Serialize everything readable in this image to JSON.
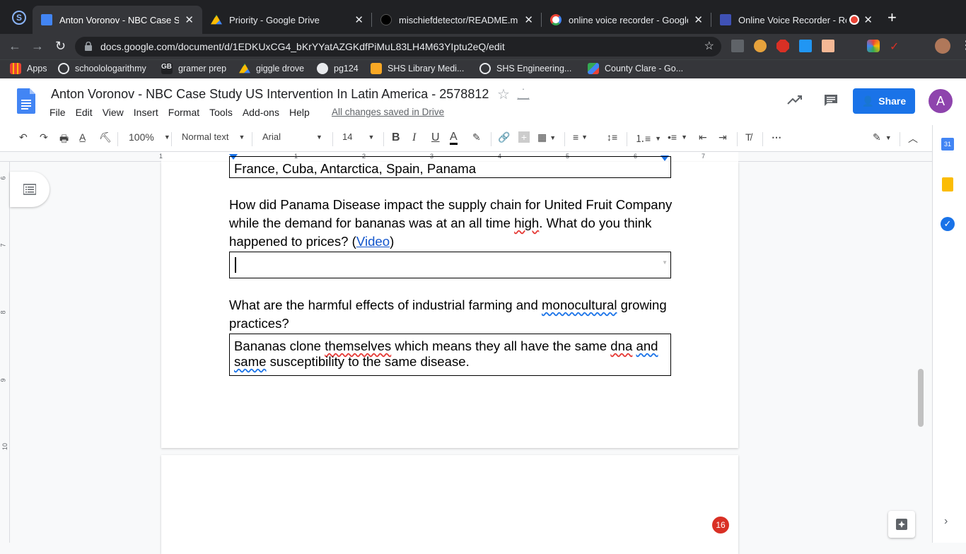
{
  "tabs": [
    {
      "title": "Anton Voronov - NBC Case Stu",
      "icon": "docs-icon",
      "color": "#4285f4"
    },
    {
      "title": "Priority - Google Drive",
      "icon": "drive-icon",
      "color": "#fbbc04"
    },
    {
      "title": "mischiefdetector/README.md",
      "icon": "github-icon",
      "color": "#202124"
    },
    {
      "title": "online voice recorder - Google",
      "icon": "google-icon",
      "color": "#ea4335"
    },
    {
      "title": "Online Voice Recorder - Re",
      "icon": "recorder-icon",
      "color": "#3f51b5"
    }
  ],
  "address": {
    "url": "docs.google.com/document/d/1EDKUxCG4_bKrYYatAZGKdfPiMuL83LH4M63YIptu2eQ/edit"
  },
  "bookmarks": [
    "Apps",
    "schoolologarithmy",
    "gramer prep",
    "giggle drove",
    "pg124",
    "SHS Library Medi...",
    "SHS Engineering...",
    "County Clare - Go..."
  ],
  "doc": {
    "title": "Anton Voronov - NBC Case Study US Intervention In Latin America - 2578812",
    "menus": [
      "File",
      "Edit",
      "View",
      "Insert",
      "Format",
      "Tools",
      "Add-ons",
      "Help"
    ],
    "saved": "All changes saved in Drive",
    "share": "Share",
    "avatar": "A"
  },
  "toolbar": {
    "zoom": "100%",
    "style": "Normal text",
    "font": "Arial",
    "size": "14"
  },
  "ruler": [
    "1",
    "1",
    "2",
    "3",
    "4",
    "5",
    "6",
    "7"
  ],
  "vruler": [
    "6",
    "7",
    "8",
    "9",
    "10"
  ],
  "content": {
    "box1": "France, Cuba, Antarctica, Spain, Panama",
    "q2_a": "How did Panama Disease impact the supply chain for United Fruit Company while the demand for bananas was at an all time ",
    "q2_b": "high",
    "q2_c": ". What do you think happened to prices? (",
    "q2_link": "Video",
    "q2_d": ")",
    "q3_a": "What are the harmful effects of industrial farming and ",
    "q3_b": "monocultural",
    "q3_c": " growing practices?",
    "a3_a": "Bananas clone ",
    "a3_b": "themselves",
    "a3_c": " which means they all have the same ",
    "a3_d": "dna",
    "a3_e": " ",
    "a3_f": "and",
    "a3_g": " ",
    "a3_h": "same",
    "a3_i": " susceptibility to the same disease."
  },
  "badge": "16",
  "colors": {
    "accent": "#1a73e8",
    "avatar": "#8e44ad",
    "badge": "#d93025"
  }
}
